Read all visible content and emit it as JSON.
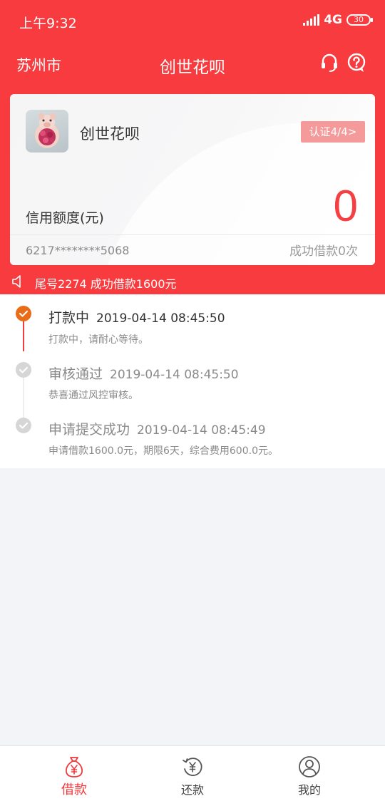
{
  "status_bar": {
    "time": "上午9:32",
    "network": "4G",
    "battery": "30"
  },
  "nav": {
    "city": "苏州市",
    "title": "创世花呗"
  },
  "card": {
    "name": "创世花呗",
    "cert_badge": "认证4/4>",
    "credit_label": "信用额度(元)",
    "credit_amount": "0",
    "card_number": "6217********5068",
    "loan_count": "成功借款0次"
  },
  "notice": {
    "text": "尾号2274 成功借款1600元"
  },
  "timeline": [
    {
      "title": "打款中",
      "time": "2019-04-14 08:45:50",
      "desc": "打款中，请耐心等待。",
      "status": "active"
    },
    {
      "title": "审核通过",
      "time": "2019-04-14 08:45:50",
      "desc": "恭喜通过风控审核。",
      "status": "done"
    },
    {
      "title": "申请提交成功",
      "time": "2019-04-14 08:45:49",
      "desc": "申请借款1600.0元，期限6天，综合费用600.0元。",
      "status": "done"
    }
  ],
  "tabs": [
    {
      "label": "借款",
      "icon": "money-bag-icon",
      "active": true
    },
    {
      "label": "还款",
      "icon": "refresh-yen-icon",
      "active": false
    },
    {
      "label": "我的",
      "icon": "user-icon",
      "active": false
    }
  ],
  "colors": {
    "brand_red": "#f73b3e",
    "active_orange": "#ea6c17",
    "badge_pink": "#f59a9b"
  }
}
